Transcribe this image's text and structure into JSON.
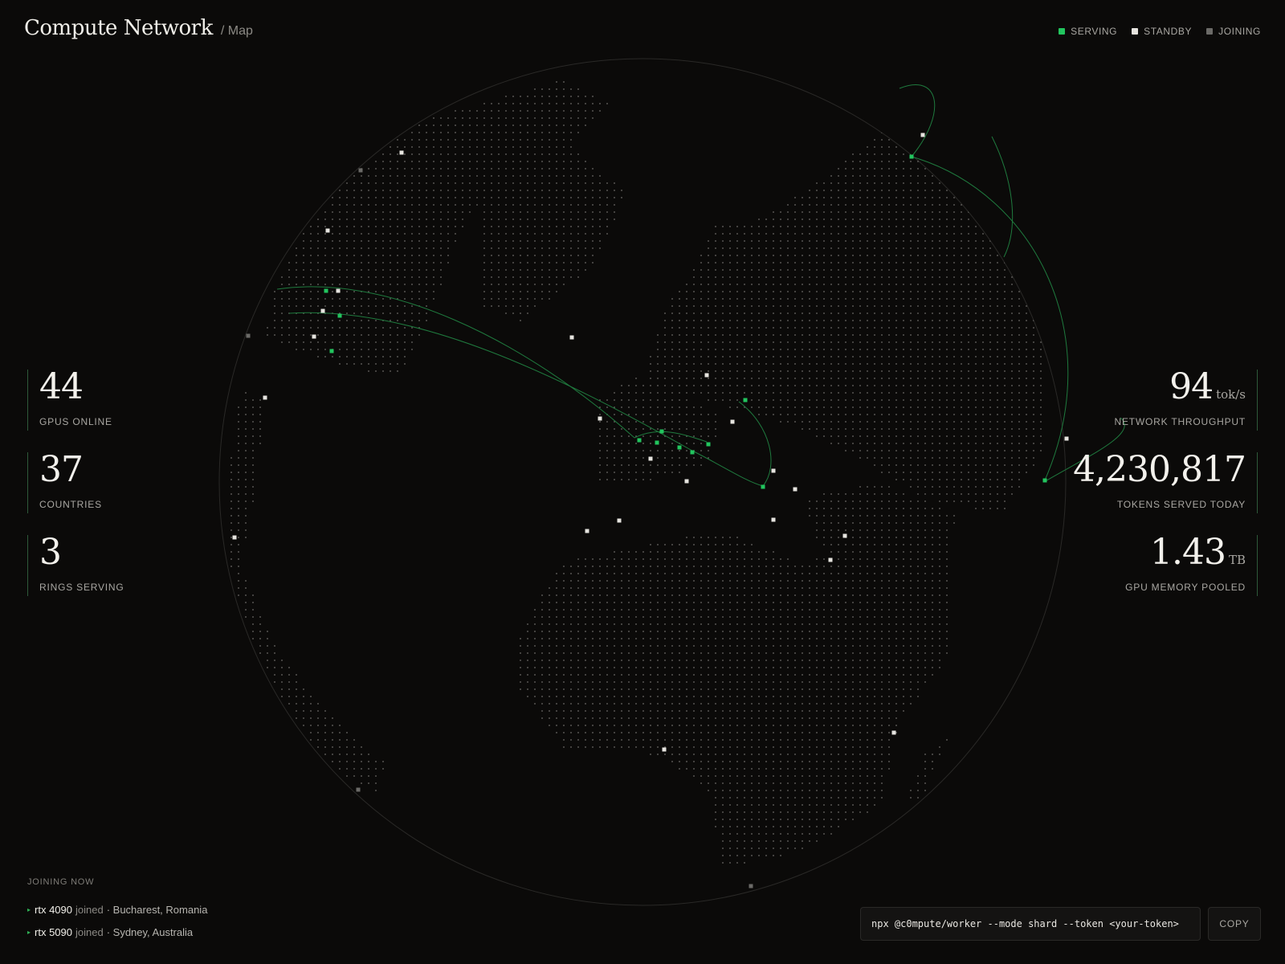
{
  "header": {
    "title": "Compute Network",
    "breadcrumb": "/ Map"
  },
  "legend": [
    {
      "label": "SERVING",
      "color": "#22c55e"
    },
    {
      "label": "STANDBY",
      "color": "#e6e4df"
    },
    {
      "label": "JOINING",
      "color": "#6b6a67"
    }
  ],
  "stats_left": [
    {
      "value": "44",
      "label": "GPUS ONLINE"
    },
    {
      "value": "37",
      "label": "COUNTRIES"
    },
    {
      "value": "3",
      "label": "RINGS SERVING"
    }
  ],
  "stats_right": [
    {
      "value": "94",
      "unit": "tok/s",
      "label": "NETWORK THROUGHPUT"
    },
    {
      "value": "4,230,817",
      "unit": "",
      "label": "TOKENS SERVED TODAY"
    },
    {
      "value": "1.43",
      "unit": "TB",
      "label": "GPU MEMORY POOLED"
    }
  ],
  "joining": {
    "title": "JOINING NOW",
    "items": [
      {
        "gpu": "rtx 4090",
        "verb": "joined",
        "location": "· Bucharest, Romania"
      },
      {
        "gpu": "rtx 5090",
        "verb": "joined",
        "location": "· Sydney, Australia"
      }
    ]
  },
  "command": {
    "text": "npx @c0mpute/worker --mode shard --token <your-token>",
    "copy_label": "COPY"
  },
  "colors": {
    "background": "#0b0a09",
    "serving": "#22c55e",
    "standby": "#e6e4df",
    "joining": "#6b6a67",
    "dots": "#bdbbb6"
  }
}
